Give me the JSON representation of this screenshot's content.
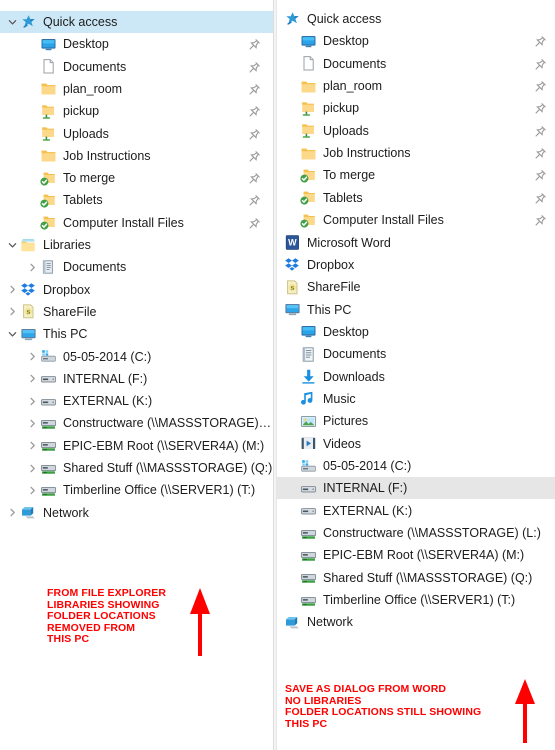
{
  "left_panel": {
    "name": "file-explorer-navigation-pane",
    "selected_item": "Quick access",
    "rows": [
      {
        "label": "Quick access",
        "icon": "star-pin-icon",
        "chevron": "down",
        "indent": 0,
        "selected": true,
        "pin": false
      },
      {
        "label": "Desktop",
        "icon": "desktop-icon",
        "chevron": "none",
        "indent": 1,
        "selected": false,
        "pin": true
      },
      {
        "label": "Documents",
        "icon": "document-blank-icon",
        "chevron": "none",
        "indent": 1,
        "selected": false,
        "pin": true
      },
      {
        "label": "plan_room",
        "icon": "folder-icon",
        "chevron": "none",
        "indent": 1,
        "selected": false,
        "pin": true
      },
      {
        "label": "pickup",
        "icon": "folder-shared-icon",
        "chevron": "none",
        "indent": 1,
        "selected": false,
        "pin": true
      },
      {
        "label": "Uploads",
        "icon": "folder-shared-icon",
        "chevron": "none",
        "indent": 1,
        "selected": false,
        "pin": true
      },
      {
        "label": "Job Instructions",
        "icon": "folder-icon",
        "chevron": "none",
        "indent": 1,
        "selected": false,
        "pin": true
      },
      {
        "label": "To merge",
        "icon": "folder-sync-icon",
        "chevron": "none",
        "indent": 1,
        "selected": false,
        "pin": true
      },
      {
        "label": "Tablets",
        "icon": "folder-sync-icon",
        "chevron": "none",
        "indent": 1,
        "selected": false,
        "pin": true
      },
      {
        "label": "Computer Install Files",
        "icon": "folder-sync-icon",
        "chevron": "none",
        "indent": 1,
        "selected": false,
        "pin": true
      },
      {
        "label": "Libraries",
        "icon": "libraries-icon",
        "chevron": "down",
        "indent": 0,
        "selected": false,
        "pin": false
      },
      {
        "label": "Documents",
        "icon": "library-document-icon",
        "chevron": "right",
        "indent": 1,
        "selected": false,
        "pin": false
      },
      {
        "label": "Dropbox",
        "icon": "dropbox-icon",
        "chevron": "right",
        "indent": 0,
        "selected": false,
        "pin": false
      },
      {
        "label": "ShareFile",
        "icon": "sharefile-icon",
        "chevron": "right",
        "indent": 0,
        "selected": false,
        "pin": false
      },
      {
        "label": "This PC",
        "icon": "this-pc-icon",
        "chevron": "down",
        "indent": 0,
        "selected": false,
        "pin": false
      },
      {
        "label": "05-05-2014 (C:)",
        "icon": "system-drive-icon",
        "chevron": "right",
        "indent": 1,
        "selected": false,
        "pin": false
      },
      {
        "label": "INTERNAL (F:)",
        "icon": "drive-icon",
        "chevron": "right",
        "indent": 1,
        "selected": false,
        "pin": false
      },
      {
        "label": "EXTERNAL (K:)",
        "icon": "drive-icon",
        "chevron": "right",
        "indent": 1,
        "selected": false,
        "pin": false
      },
      {
        "label": "Constructware (\\\\MASSSTORAGE) (L:)",
        "icon": "network-drive-icon",
        "chevron": "right",
        "indent": 1,
        "selected": false,
        "pin": false
      },
      {
        "label": "EPIC-EBM Root (\\\\SERVER4A) (M:)",
        "icon": "network-drive-icon",
        "chevron": "right",
        "indent": 1,
        "selected": false,
        "pin": false
      },
      {
        "label": "Shared Stuff (\\\\MASSSTORAGE) (Q:)",
        "icon": "network-drive-icon",
        "chevron": "right",
        "indent": 1,
        "selected": false,
        "pin": false
      },
      {
        "label": "Timberline Office (\\\\SERVER1) (T:)",
        "icon": "network-drive-icon",
        "chevron": "right",
        "indent": 1,
        "selected": false,
        "pin": false
      },
      {
        "label": "Network",
        "icon": "network-icon",
        "chevron": "right",
        "indent": 0,
        "selected": false,
        "pin": false
      }
    ],
    "annotation": {
      "text": "FROM FILE EXPLORER\nLIBRARIES SHOWING\nFOLDER LOCATIONS\nREMOVED FROM\nTHIS PC",
      "color": "#ff0000",
      "arrow": "up-arrow-icon"
    }
  },
  "right_panel": {
    "name": "save-as-dialog-navigation-pane",
    "selected_item": "INTERNAL (F:)",
    "rows": [
      {
        "label": "Quick access",
        "icon": "star-pin-icon",
        "chevron": "none",
        "indent": 0,
        "selected": false,
        "pin": false
      },
      {
        "label": "Desktop",
        "icon": "desktop-icon",
        "chevron": "none",
        "indent": 1,
        "selected": false,
        "pin": true
      },
      {
        "label": "Documents",
        "icon": "document-blank-icon",
        "chevron": "none",
        "indent": 1,
        "selected": false,
        "pin": true
      },
      {
        "label": "plan_room",
        "icon": "folder-icon",
        "chevron": "none",
        "indent": 1,
        "selected": false,
        "pin": true
      },
      {
        "label": "pickup",
        "icon": "folder-shared-icon",
        "chevron": "none",
        "indent": 1,
        "selected": false,
        "pin": true
      },
      {
        "label": "Uploads",
        "icon": "folder-shared-icon",
        "chevron": "none",
        "indent": 1,
        "selected": false,
        "pin": true
      },
      {
        "label": "Job Instructions",
        "icon": "folder-icon",
        "chevron": "none",
        "indent": 1,
        "selected": false,
        "pin": true
      },
      {
        "label": "To merge",
        "icon": "folder-sync-icon",
        "chevron": "none",
        "indent": 1,
        "selected": false,
        "pin": true
      },
      {
        "label": "Tablets",
        "icon": "folder-sync-icon",
        "chevron": "none",
        "indent": 1,
        "selected": false,
        "pin": true
      },
      {
        "label": "Computer Install Files",
        "icon": "folder-sync-icon",
        "chevron": "none",
        "indent": 1,
        "selected": false,
        "pin": true
      },
      {
        "label": "Microsoft Word",
        "icon": "word-icon",
        "chevron": "none",
        "indent": 0,
        "selected": false,
        "pin": false
      },
      {
        "label": "Dropbox",
        "icon": "dropbox-icon",
        "chevron": "none",
        "indent": 0,
        "selected": false,
        "pin": false
      },
      {
        "label": "ShareFile",
        "icon": "sharefile-icon",
        "chevron": "none",
        "indent": 0,
        "selected": false,
        "pin": false
      },
      {
        "label": "This PC",
        "icon": "this-pc-icon",
        "chevron": "none",
        "indent": 0,
        "selected": false,
        "pin": false
      },
      {
        "label": "Desktop",
        "icon": "desktop-icon",
        "chevron": "none",
        "indent": 1,
        "selected": false,
        "pin": false
      },
      {
        "label": "Documents",
        "icon": "documents-lined-icon",
        "chevron": "none",
        "indent": 1,
        "selected": false,
        "pin": false
      },
      {
        "label": "Downloads",
        "icon": "downloads-arrow-icon",
        "chevron": "none",
        "indent": 1,
        "selected": false,
        "pin": false
      },
      {
        "label": "Music",
        "icon": "music-note-icon",
        "chevron": "none",
        "indent": 1,
        "selected": false,
        "pin": false
      },
      {
        "label": "Pictures",
        "icon": "pictures-icon",
        "chevron": "none",
        "indent": 1,
        "selected": false,
        "pin": false
      },
      {
        "label": "Videos",
        "icon": "videos-icon",
        "chevron": "none",
        "indent": 1,
        "selected": false,
        "pin": false
      },
      {
        "label": "05-05-2014 (C:)",
        "icon": "system-drive-icon",
        "chevron": "none",
        "indent": 1,
        "selected": false,
        "pin": false
      },
      {
        "label": "INTERNAL (F:)",
        "icon": "drive-icon",
        "chevron": "none",
        "indent": 1,
        "selected": true,
        "pin": false
      },
      {
        "label": "EXTERNAL (K:)",
        "icon": "drive-icon",
        "chevron": "none",
        "indent": 1,
        "selected": false,
        "pin": false
      },
      {
        "label": "Constructware (\\\\MASSSTORAGE) (L:)",
        "icon": "network-drive-icon",
        "chevron": "none",
        "indent": 1,
        "selected": false,
        "pin": false
      },
      {
        "label": "EPIC-EBM Root (\\\\SERVER4A) (M:)",
        "icon": "network-drive-icon",
        "chevron": "none",
        "indent": 1,
        "selected": false,
        "pin": false
      },
      {
        "label": "Shared Stuff (\\\\MASSSTORAGE) (Q:)",
        "icon": "network-drive-icon",
        "chevron": "none",
        "indent": 1,
        "selected": false,
        "pin": false
      },
      {
        "label": "Timberline Office (\\\\SERVER1) (T:)",
        "icon": "network-drive-icon",
        "chevron": "none",
        "indent": 1,
        "selected": false,
        "pin": false
      },
      {
        "label": "Network",
        "icon": "network-icon",
        "chevron": "none",
        "indent": 0,
        "selected": false,
        "pin": false
      }
    ],
    "annotation": {
      "text": "SAVE AS DIALOG FROM WORD\nNO LIBRARIES\nFOLDER LOCATIONS STILL SHOWING\nTHIS PC",
      "color": "#ff0000",
      "arrow": "up-arrow-icon"
    }
  },
  "colors": {
    "selection_blue": "#cce8f7",
    "selection_gray": "#e6e6e6",
    "annotation_red": "#ff0000",
    "text": "#1c1c1c",
    "chevron": "#767676"
  }
}
